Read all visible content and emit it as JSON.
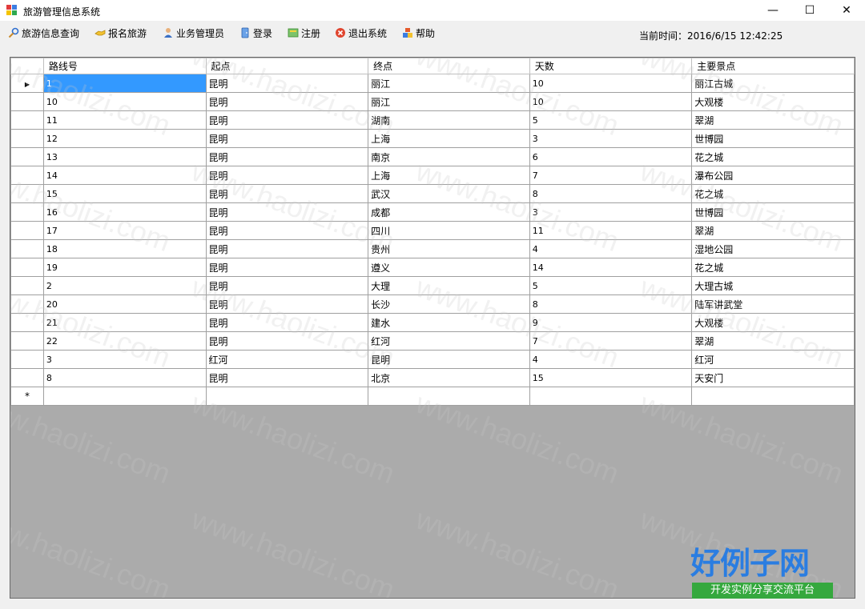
{
  "window": {
    "title": "旅游管理信息系统",
    "minimize": "—",
    "maximize": "☐",
    "close": "✕"
  },
  "menu": {
    "items": [
      {
        "label": "旅游信息查询",
        "icon": "search-icon"
      },
      {
        "label": "报名旅游",
        "icon": "handshake-icon"
      },
      {
        "label": "业务管理员",
        "icon": "user-icon"
      },
      {
        "label": "登录",
        "icon": "login-icon"
      },
      {
        "label": "注册",
        "icon": "register-icon"
      },
      {
        "label": "退出系统",
        "icon": "exit-icon"
      },
      {
        "label": "帮助",
        "icon": "help-icon"
      }
    ],
    "clock": "当前时间：2016/6/15 12:42:25"
  },
  "grid": {
    "columns": [
      "路线号",
      "起点",
      "终点",
      "天数",
      "主要景点"
    ],
    "rows": [
      [
        "1",
        "昆明",
        "丽江",
        "10",
        "丽江古城"
      ],
      [
        "10",
        "昆明",
        "丽江",
        "10",
        "大观楼"
      ],
      [
        "11",
        "昆明",
        "湖南",
        "5",
        "翠湖"
      ],
      [
        "12",
        "昆明",
        "上海",
        "3",
        "世博园"
      ],
      [
        "13",
        "昆明",
        "南京",
        "6",
        "花之城"
      ],
      [
        "14",
        "昆明",
        "上海",
        "7",
        "瀑布公园"
      ],
      [
        "15",
        "昆明",
        "武汉",
        "8",
        "花之城"
      ],
      [
        "16",
        "昆明",
        "成都",
        "3",
        "世博园"
      ],
      [
        "17",
        "昆明",
        "四川",
        "11",
        "翠湖"
      ],
      [
        "18",
        "昆明",
        "贵州",
        "4",
        "湿地公园"
      ],
      [
        "19",
        "昆明",
        "遵义",
        "14",
        "花之城"
      ],
      [
        "2",
        "昆明",
        "大理",
        "5",
        "大理古城"
      ],
      [
        "20",
        "昆明",
        "长沙",
        "8",
        "陆军讲武堂"
      ],
      [
        "21",
        "昆明",
        "建水",
        "9",
        "大观楼"
      ],
      [
        "22",
        "昆明",
        "红河",
        "7",
        "翠湖"
      ],
      [
        "3",
        "红河",
        "昆明",
        "4",
        "红河"
      ],
      [
        "8",
        "昆明",
        "北京",
        "15",
        "天安门"
      ]
    ],
    "current_marker": "▶",
    "new_marker": "*"
  },
  "watermark": {
    "text": "www.haolizi.com",
    "logo_main": "好例子网",
    "logo_sub": "开发实例分享交流平台"
  },
  "colors": {
    "selection": "#3399ff",
    "grid_bg": "#ababab",
    "logo_blue": "#2a7de1",
    "logo_green": "#35a83e"
  }
}
